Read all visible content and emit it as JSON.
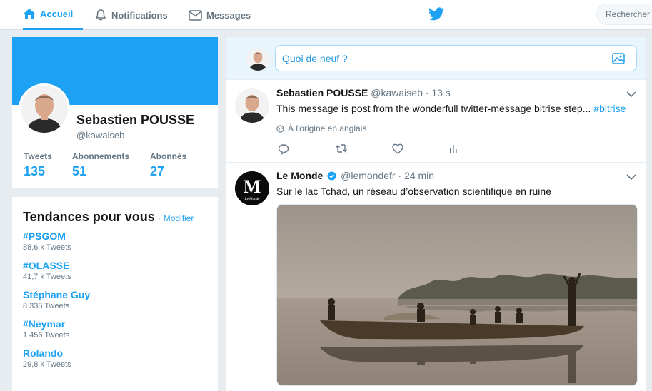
{
  "nav": {
    "home_label": "Accueil",
    "notifications_label": "Notifications",
    "messages_label": "Messages",
    "search_placeholder": "Rechercher"
  },
  "profile": {
    "name": "Sebastien POUSSE",
    "handle": "@kawaiseb",
    "stats": [
      {
        "label": "Tweets",
        "value": "135"
      },
      {
        "label": "Abonnements",
        "value": "51"
      },
      {
        "label": "Abonnés",
        "value": "27"
      }
    ]
  },
  "trends": {
    "title": "Tendances pour vous",
    "dot": "·",
    "edit_label": "Modifier",
    "items": [
      {
        "name": "#PSGOM",
        "count": "88,6 k Tweets"
      },
      {
        "name": "#OLASSE",
        "count": "41,7 k Tweets"
      },
      {
        "name": "Stéphane Guy",
        "count": "8 335 Tweets"
      },
      {
        "name": "#Neymar",
        "count": "1 456 Tweets"
      },
      {
        "name": "Rolando",
        "count": "29,8 k Tweets"
      }
    ]
  },
  "composer": {
    "placeholder": "Quoi de neuf ?"
  },
  "tweets": [
    {
      "name": "Sebastien POUSSE",
      "handle": "@kawaiseb",
      "sep": "·",
      "time": "13 s",
      "text": "This message is post from the wonderfull twitter-message bitrise step...",
      "hashtag": "#bitrise",
      "translate": "À l'origine en anglais"
    },
    {
      "name": "Le Monde",
      "handle": "@lemondefr",
      "sep": "·",
      "time": "24 min",
      "text": "Sur le lac Tchad, un réseau d’observation scientifique en ruine",
      "logo_text": "Le Monde"
    }
  ],
  "colors": {
    "accent": "#1da1f2",
    "background": "#e6ecf0",
    "muted": "#657786"
  }
}
